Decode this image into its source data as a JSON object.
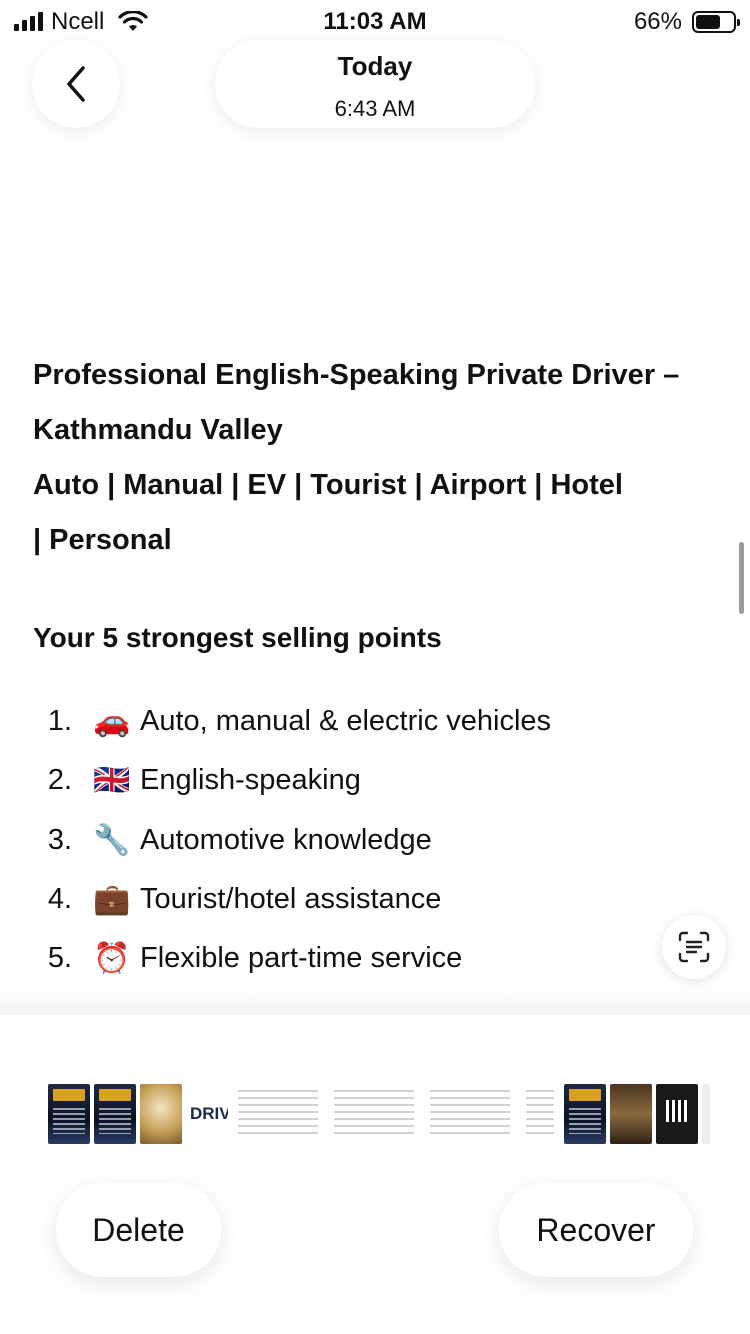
{
  "status_bar": {
    "carrier": "Ncell",
    "time": "11:03 AM",
    "battery_percent": "66%",
    "battery_level": 0.66
  },
  "header": {
    "date_label": "Today",
    "time_label": "6:43 AM"
  },
  "document": {
    "heading_lines": [
      "Professional English-Speaking Private Driver –",
      "Kathmandu Valley",
      "Auto | Manual | EV | Tourist | Airport | Hotel",
      "| Personal"
    ],
    "subheading": "Your 5 strongest selling points",
    "points": [
      {
        "num": "1.",
        "emoji": "🚗",
        "text": "Auto, manual & electric vehicles"
      },
      {
        "num": "2.",
        "emoji": "🇬🇧",
        "text": "English-speaking"
      },
      {
        "num": "3.",
        "emoji": "🔧",
        "text": "Automotive knowledge"
      },
      {
        "num": "4.",
        "emoji": "💼",
        "text": "Tourist/hotel assistance"
      },
      {
        "num": "5.",
        "emoji": "⏰",
        "text": "Flexible part-time service"
      }
    ]
  },
  "thumbnail_strip": {
    "drv_label": "DRIV"
  },
  "actions": {
    "delete_label": "Delete",
    "recover_label": "Recover"
  },
  "icons": {
    "back": "chevron-left-icon",
    "live_text": "live-text-icon",
    "signal": "cellular-signal-icon",
    "wifi": "wifi-icon",
    "battery": "battery-icon"
  }
}
